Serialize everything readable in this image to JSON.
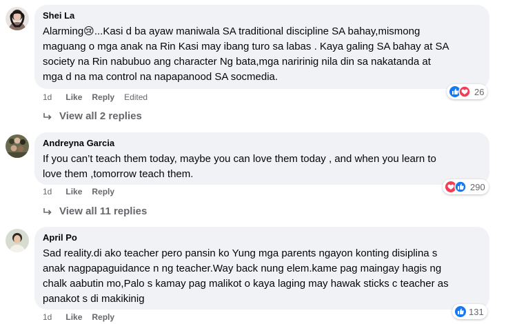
{
  "comments": [
    {
      "author": "Shei La",
      "lines": [
        "Alarming😢...Kasi d ba ayaw maniwala SA traditional discipline SA bahay,mismong",
        "maguang o mga anak na Rin Kasi may ibang turo sa labas . Kaya galing SA bahay at SA",
        "society na Rin nabubuo ang character Ng bata,mga naririnig nila din sa nakatanda at",
        "mga d na ma control na napapanood SA socmedia."
      ],
      "time": "1d",
      "like_label": "Like",
      "reply_label": "Reply",
      "edited_label": "Edited",
      "reaction_count": "26",
      "view_replies": "View all 2 replies"
    },
    {
      "author": "Andreyna Garcia",
      "lines": [
        "If you can’t teach them today, maybe you can love them today , and when you learn to",
        "love them ,tomorrow teach them."
      ],
      "time": "1d",
      "like_label": "Like",
      "reply_label": "Reply",
      "reaction_count": "290",
      "view_replies": "View all 11 replies"
    },
    {
      "author": "April Po",
      "lines": [
        "Sad reality.di ako teacher pero pansin ko Yung mga parents ngayon konting disiplina s",
        "anak nagpapaguidance n ng teacher.Way back nung elem.kame pag maingay hagis ng",
        "chalk aabutin mo,Palo s kamay pag malikot o kaya laging may hawak sticks c teacher as",
        "panakot s di makikinig"
      ],
      "time": "1d",
      "like_label": "Like",
      "reply_label": "Reply",
      "reaction_count": "131"
    }
  ],
  "colors": {
    "bubble": "#f0f2f5",
    "like_blue": "#1877f2",
    "love_red": "#f33e58",
    "meta_gray": "#65676b"
  }
}
